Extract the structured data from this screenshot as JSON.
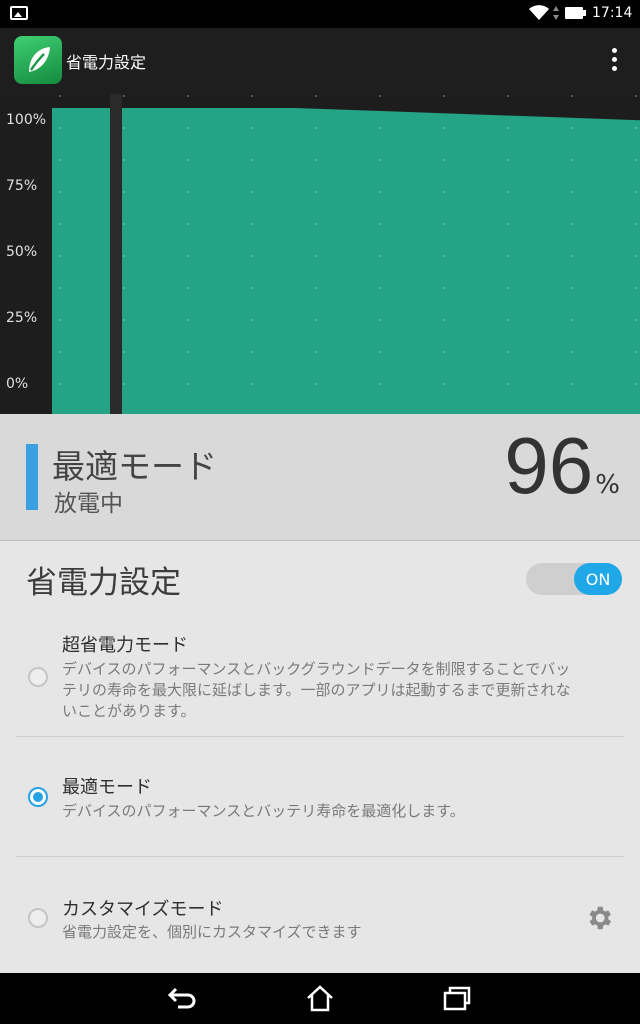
{
  "status_bar": {
    "time": "17:14"
  },
  "app_bar": {
    "title": "省電力設定"
  },
  "chart_data": {
    "type": "area",
    "title": "",
    "y_ticks": [
      "100%",
      "75%",
      "50%",
      "25%",
      "0%"
    ],
    "ylim": [
      0,
      100
    ],
    "series": [
      {
        "values": [
          100,
          100,
          100,
          99,
          98,
          97,
          96
        ]
      }
    ],
    "fill_color": "#25a385",
    "grid": true
  },
  "current_mode": {
    "name": "最適モード",
    "state": "放電中",
    "percent_value": "96",
    "percent_unit": "%",
    "accent": "#3aa0e0"
  },
  "settings": {
    "title": "省電力設定",
    "toggle_label": "ON",
    "options": [
      {
        "title": "超省電力モード",
        "description": "デバイスのパフォーマンスとバックグラウンドデータを制限することでバッテリの寿命を最大限に延ばします。一部のアプリは起動するまで更新されないことがあります。",
        "selected": false
      },
      {
        "title": "最適モード",
        "description": "デバイスのパフォーマンスとバッテリ寿命を最適化します。",
        "selected": true
      },
      {
        "title": "カスタマイズモード",
        "description": "省電力設定を、個別にカスタマイズできます",
        "selected": false
      }
    ]
  },
  "icons": {
    "app": "leaf-icon",
    "overflow": "more-vert-icon",
    "settings": "gear-icon",
    "back": "back-icon",
    "home": "home-icon",
    "recents": "recents-icon"
  }
}
